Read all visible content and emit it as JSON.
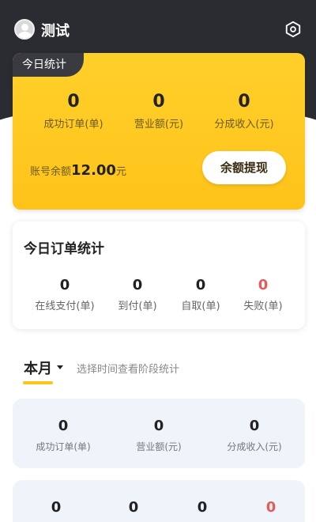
{
  "header": {
    "user_name": "测试",
    "avatar_icon": "user-avatar-icon",
    "settings_icon": "settings-hexagon-icon"
  },
  "today": {
    "tag": "今日统计",
    "stats": [
      {
        "value": "0",
        "label": "成功订单(单)"
      },
      {
        "value": "0",
        "label": "营业额(元)"
      },
      {
        "value": "0",
        "label": "分成收入(元)"
      }
    ],
    "balance_label": "账号余额",
    "balance_amount": "12.00",
    "balance_unit": "元",
    "withdraw_label": "余额提现"
  },
  "orders": {
    "title": "今日订单统计",
    "stats": [
      {
        "value": "0",
        "label": "在线支付(单)"
      },
      {
        "value": "0",
        "label": "到付(单)"
      },
      {
        "value": "0",
        "label": "自取(单)"
      },
      {
        "value": "0",
        "label": "失败(单)"
      }
    ],
    "fail_color": "#e75a5a"
  },
  "month": {
    "title": "本月",
    "hint": "选择时间查看阶段统计",
    "stats": [
      {
        "value": "0",
        "label": "成功订单(单)"
      },
      {
        "value": "0",
        "label": "营业额(元)"
      },
      {
        "value": "0",
        "label": "分成收入(元)"
      }
    ],
    "stats2": [
      "0",
      "0",
      "0",
      "0"
    ]
  },
  "colors": {
    "header_bg": "#2b2c31",
    "accent_yellow": "#ffc31a",
    "card_blue": "#eff4fb"
  }
}
